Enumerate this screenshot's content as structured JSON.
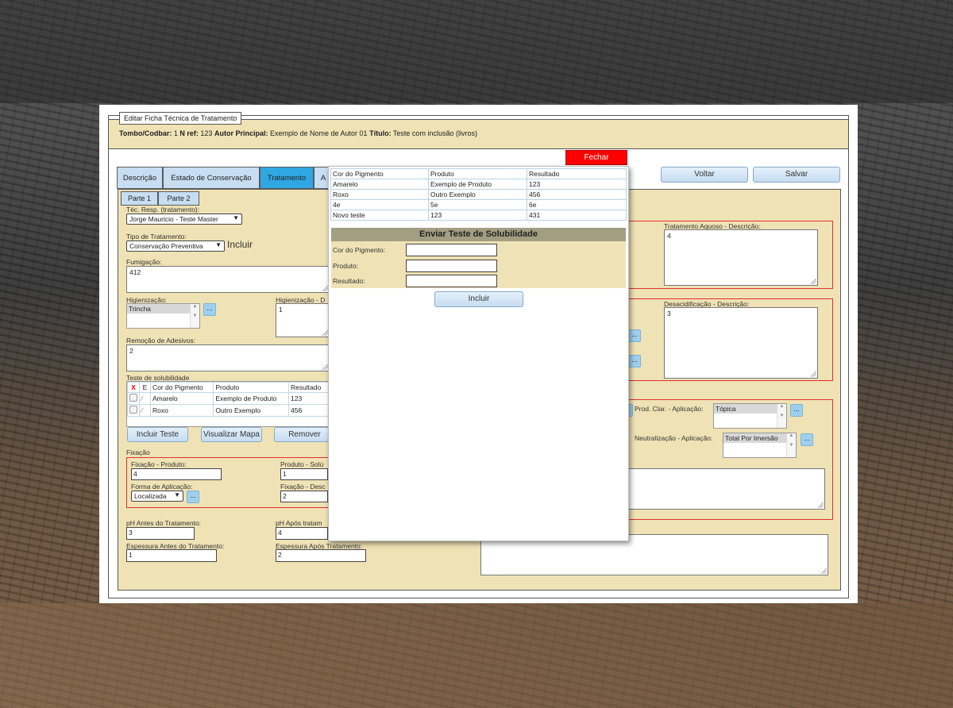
{
  "window": {
    "legend": "Editar Ficha Técnica de Tratamento",
    "header": {
      "tombo_label": "Tombo/Codbar:",
      "tombo_value": "1",
      "nref_label": "N ref:",
      "nref_value": "123",
      "autor_label": "Autor Principal:",
      "autor_value": "Exemplo de Nome de Autor 01",
      "titulo_label": "Título:",
      "titulo_value": "Teste com inclusão (livros)"
    }
  },
  "actions": {
    "fechar": "Fechar",
    "voltar": "Voltar",
    "salvar": "Salvar"
  },
  "tabs": [
    "Descrição",
    "Estado de Conservação",
    "Tratamento",
    "A"
  ],
  "subtabs": [
    "Parte 1",
    "Parte 2"
  ],
  "form": {
    "tec_resp_label": "Téc. Resp. (tratamento):",
    "tec_resp_value": "Jorge Mauricio - Teste Master",
    "tipo_label": "Tipo de Tratamento:",
    "tipo_value": "Conservação Preventiva",
    "incluir_link": "Incluir",
    "fumigacao_label": "Fumigação:",
    "fumigacao_value": "412",
    "higienizacao_label": "Higienização:",
    "higienizacao_value": "Trincha",
    "higienizacao_desc_label": "Higienização - D",
    "higienizacao_desc_value": "1",
    "remocao_label": "Remoção de Adesivos:",
    "remocao_value": "2",
    "solub_label": "Teste de solubilidade",
    "solub_headers": [
      "X",
      "E",
      "Cor do Pigmento",
      "Produto",
      "Resultado"
    ],
    "solub_rows": [
      {
        "cor": "Amarelo",
        "produto": "Exemplo de Produto",
        "resultado": "123"
      },
      {
        "cor": "Roxo",
        "produto": "Outro Exemplo",
        "resultado": "456"
      }
    ],
    "incluir_teste": "Incluir Teste",
    "visualizar_mapa": "Visualizar Mapa",
    "remover": "Remover",
    "fixacao_label": "Fixação",
    "fixacao_produto_label": "Fixação - Produto:",
    "fixacao_produto_value": "4",
    "produto_solu_label": "Produto - Solú",
    "produto_solu_value": "1",
    "forma_aplicacao_label": "Forma de Aplicação:",
    "forma_aplicacao_value": "Localizada",
    "fixacao_desc_label": "Fixação - Desc",
    "fixacao_desc_value": "2",
    "ph_antes_label": "pH Antes do Tratamento:",
    "ph_antes_value": "3",
    "ph_apos_label": "pH Após tratam",
    "ph_apos_value": "4",
    "esp_antes_label": "Espessura Antes do Tratamento:",
    "esp_antes_value": "1",
    "esp_apos_label": "Espessura Após Tratamento:",
    "esp_apos_value": "2",
    "aquoso_label": "Tratamento Aquoso - Descrição:",
    "aquoso_value": "4",
    "desacid_label": "Desacidificação - Descrição:",
    "desacid_value": "3",
    "prod_clar_label": "Prod. Clar. - Aplicação:",
    "prod_clar_value": "Tópica",
    "neutral_label": "Neutralização - Aplicação:",
    "neutral_value": "Total Por Imersão"
  },
  "popup": {
    "headers": [
      "Cor do Pigmento",
      "Produto",
      "Resultado"
    ],
    "rows": [
      [
        "Amarelo",
        "Exemplo de Produto",
        "123"
      ],
      [
        "Roxo",
        "Outro Exemplo",
        "456"
      ],
      [
        "4e",
        "5e",
        "6e"
      ],
      [
        "Novo teste",
        "123",
        "431"
      ]
    ],
    "form_title": "Enviar Teste de Solubilidade",
    "cor_label": "Cor do Pigmento:",
    "produto_label": "Produto:",
    "resultado_label": "Resultado:",
    "incluir": "Incluir"
  }
}
